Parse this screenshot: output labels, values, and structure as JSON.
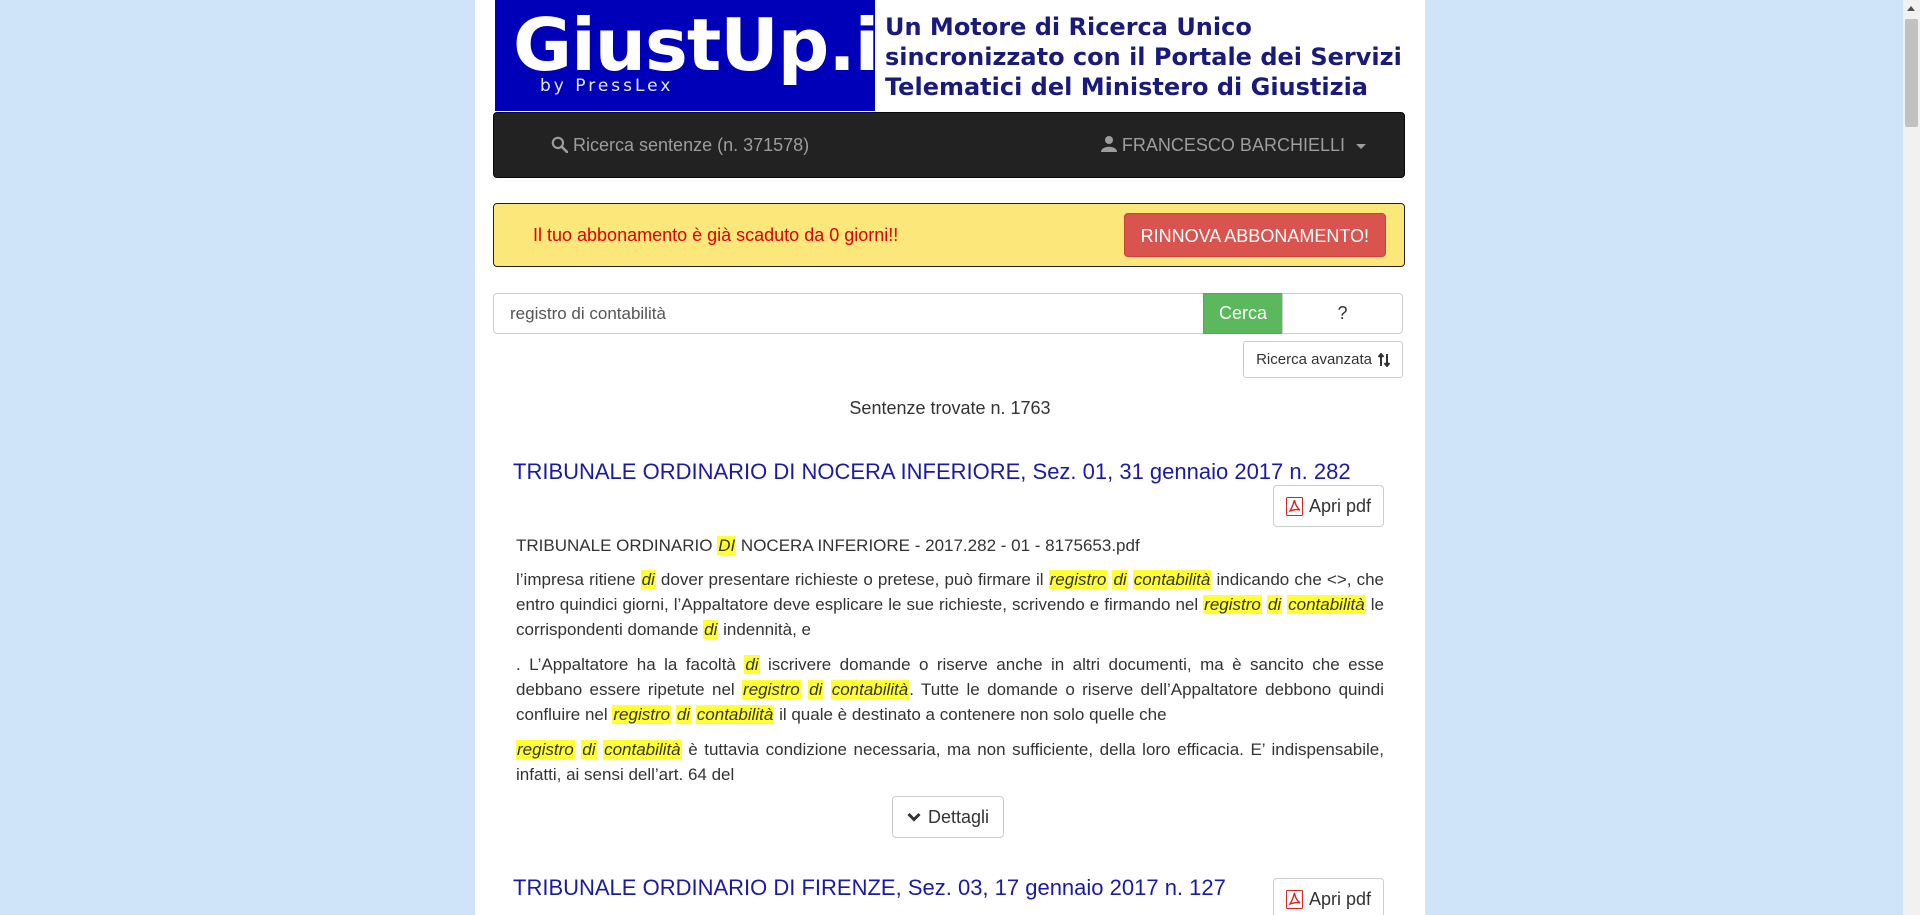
{
  "banner": {
    "logo": "GiustUp.it",
    "logo_sub": "by PressLex",
    "tagline": [
      "Un Motore di Ricerca Unico",
      "sincronizzato con il Portale dei Servizi",
      "Telematici del Ministero di Giustizia"
    ]
  },
  "navbar": {
    "search_label": "Ricerca sentenze (n. 371578)",
    "user_label": "FRANCESCO BARCHIELLI"
  },
  "alert": {
    "message": "Il tuo abbonamento è già scaduto da 0 giorni!!",
    "button": "RINNOVA ABBONAMENTO!"
  },
  "search": {
    "value": "registro di contabilità",
    "button": "Cerca",
    "help": "?",
    "advanced": "Ricerca avanzata"
  },
  "results_count": "Sentenze trovate n. 1763",
  "results": [
    {
      "title": "TRIBUNALE ORDINARIO DI NOCERA INFERIORE, Sez. 01, 31 gennaio 2017 n. 282",
      "pdf_button": "Apri pdf",
      "file_line": [
        {
          "t": "TRIBUNALE ORDINARIO "
        },
        {
          "h": "DI"
        },
        {
          "t": " NOCERA INFERIORE - 2017.282 - 01 - 8175653.pdf"
        }
      ],
      "paragraphs": [
        [
          {
            "t": "l’impresa ritiene "
          },
          {
            "h": "di"
          },
          {
            "t": " dover presentare richieste o pretese, può firmare il "
          },
          {
            "h": "registro"
          },
          {
            "t": " "
          },
          {
            "h": "di"
          },
          {
            "t": " "
          },
          {
            "h": "contabilità"
          },
          {
            "t": " indicando che <>, che entro quindici giorni, l’Appaltatore deve esplicare le sue richieste, scrivendo e firmando nel "
          },
          {
            "h": "registro"
          },
          {
            "t": " "
          },
          {
            "h": "di"
          },
          {
            "t": " "
          },
          {
            "h": "contabilità"
          },
          {
            "t": " le corrispondenti domande "
          },
          {
            "h": "di"
          },
          {
            "t": " indennità, e"
          }
        ],
        [
          {
            "t": ". L’Appaltatore ha la facoltà "
          },
          {
            "h": "di"
          },
          {
            "t": " iscrivere domande o riserve anche in altri documenti, ma è sancito che esse debbano essere ripetute nel "
          },
          {
            "h": "registro"
          },
          {
            "t": " "
          },
          {
            "h": "di"
          },
          {
            "t": " "
          },
          {
            "h": "contabilità"
          },
          {
            "t": ". Tutte le domande o riserve dell’Appaltatore debbono quindi confluire nel "
          },
          {
            "h": "registro"
          },
          {
            "t": " "
          },
          {
            "h": "di"
          },
          {
            "t": " "
          },
          {
            "h": "contabilità"
          },
          {
            "t": " il quale è destinato a contenere non solo quelle che"
          }
        ],
        [
          {
            "h": "registro"
          },
          {
            "t": " "
          },
          {
            "h": "di"
          },
          {
            "t": " "
          },
          {
            "h": "contabilità"
          },
          {
            "t": " è tuttavia condizione necessaria, ma non sufficiente, della loro efficacia. E’ indispensabile, infatti, ai sensi dell’art. 64 del"
          }
        ]
      ],
      "details_button": "Dettagli"
    },
    {
      "title": "TRIBUNALE ORDINARIO DI FIRENZE, Sez. 03, 17 gennaio 2017 n. 127",
      "pdf_button": "Apri pdf"
    }
  ],
  "colors": {
    "page_background": "#cfe4f9",
    "logo_background": "#0000b8",
    "navbar": "#222222",
    "alert_background": "#fce77a",
    "alert_text": "#e00000",
    "renew_button": "#d9534f",
    "search_button": "#5cb85c",
    "result_title": "#1a1aa6",
    "highlight": "#ffff33"
  },
  "icons": {
    "nav_search": "search-icon",
    "nav_user": "user-icon",
    "advanced": "sort-arrows-icon",
    "pdf": "pdf-icon",
    "details": "chevron-down-icon"
  }
}
